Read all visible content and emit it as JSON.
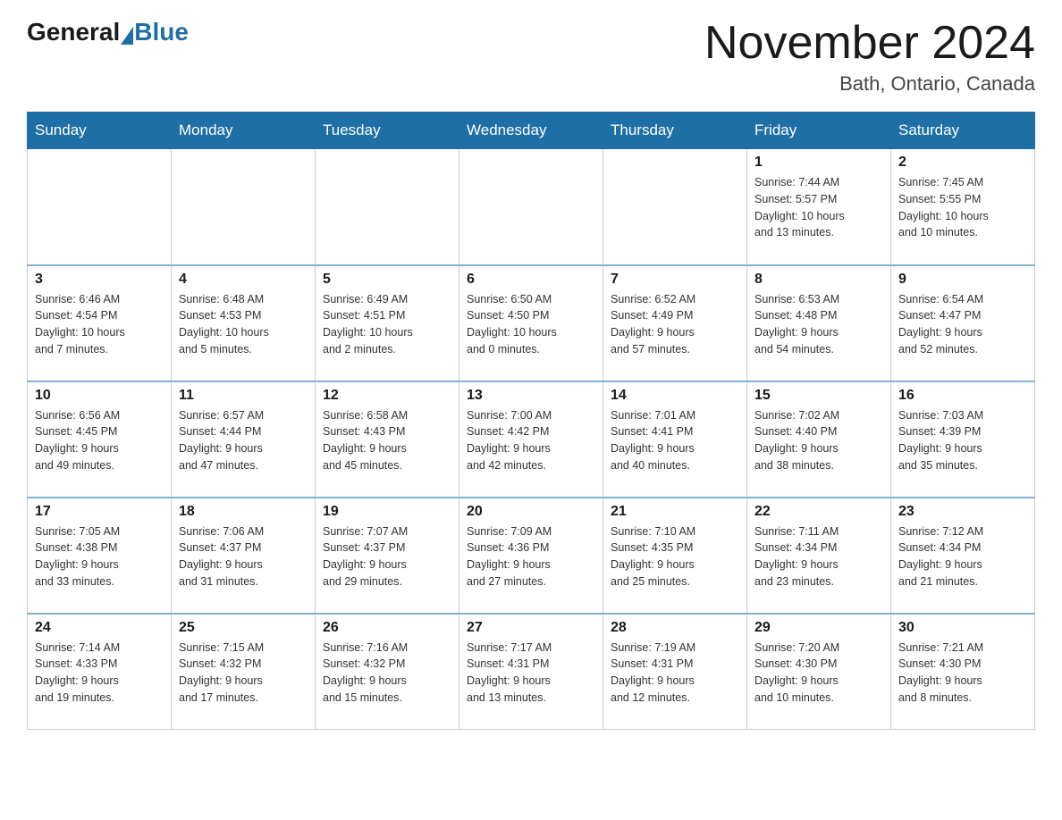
{
  "logo": {
    "general": "General",
    "blue": "Blue"
  },
  "title": "November 2024",
  "location": "Bath, Ontario, Canada",
  "days_of_week": [
    "Sunday",
    "Monday",
    "Tuesday",
    "Wednesday",
    "Thursday",
    "Friday",
    "Saturday"
  ],
  "weeks": [
    [
      {
        "day": "",
        "info": ""
      },
      {
        "day": "",
        "info": ""
      },
      {
        "day": "",
        "info": ""
      },
      {
        "day": "",
        "info": ""
      },
      {
        "day": "",
        "info": ""
      },
      {
        "day": "1",
        "info": "Sunrise: 7:44 AM\nSunset: 5:57 PM\nDaylight: 10 hours\nand 13 minutes."
      },
      {
        "day": "2",
        "info": "Sunrise: 7:45 AM\nSunset: 5:55 PM\nDaylight: 10 hours\nand 10 minutes."
      }
    ],
    [
      {
        "day": "3",
        "info": "Sunrise: 6:46 AM\nSunset: 4:54 PM\nDaylight: 10 hours\nand 7 minutes."
      },
      {
        "day": "4",
        "info": "Sunrise: 6:48 AM\nSunset: 4:53 PM\nDaylight: 10 hours\nand 5 minutes."
      },
      {
        "day": "5",
        "info": "Sunrise: 6:49 AM\nSunset: 4:51 PM\nDaylight: 10 hours\nand 2 minutes."
      },
      {
        "day": "6",
        "info": "Sunrise: 6:50 AM\nSunset: 4:50 PM\nDaylight: 10 hours\nand 0 minutes."
      },
      {
        "day": "7",
        "info": "Sunrise: 6:52 AM\nSunset: 4:49 PM\nDaylight: 9 hours\nand 57 minutes."
      },
      {
        "day": "8",
        "info": "Sunrise: 6:53 AM\nSunset: 4:48 PM\nDaylight: 9 hours\nand 54 minutes."
      },
      {
        "day": "9",
        "info": "Sunrise: 6:54 AM\nSunset: 4:47 PM\nDaylight: 9 hours\nand 52 minutes."
      }
    ],
    [
      {
        "day": "10",
        "info": "Sunrise: 6:56 AM\nSunset: 4:45 PM\nDaylight: 9 hours\nand 49 minutes."
      },
      {
        "day": "11",
        "info": "Sunrise: 6:57 AM\nSunset: 4:44 PM\nDaylight: 9 hours\nand 47 minutes."
      },
      {
        "day": "12",
        "info": "Sunrise: 6:58 AM\nSunset: 4:43 PM\nDaylight: 9 hours\nand 45 minutes."
      },
      {
        "day": "13",
        "info": "Sunrise: 7:00 AM\nSunset: 4:42 PM\nDaylight: 9 hours\nand 42 minutes."
      },
      {
        "day": "14",
        "info": "Sunrise: 7:01 AM\nSunset: 4:41 PM\nDaylight: 9 hours\nand 40 minutes."
      },
      {
        "day": "15",
        "info": "Sunrise: 7:02 AM\nSunset: 4:40 PM\nDaylight: 9 hours\nand 38 minutes."
      },
      {
        "day": "16",
        "info": "Sunrise: 7:03 AM\nSunset: 4:39 PM\nDaylight: 9 hours\nand 35 minutes."
      }
    ],
    [
      {
        "day": "17",
        "info": "Sunrise: 7:05 AM\nSunset: 4:38 PM\nDaylight: 9 hours\nand 33 minutes."
      },
      {
        "day": "18",
        "info": "Sunrise: 7:06 AM\nSunset: 4:37 PM\nDaylight: 9 hours\nand 31 minutes."
      },
      {
        "day": "19",
        "info": "Sunrise: 7:07 AM\nSunset: 4:37 PM\nDaylight: 9 hours\nand 29 minutes."
      },
      {
        "day": "20",
        "info": "Sunrise: 7:09 AM\nSunset: 4:36 PM\nDaylight: 9 hours\nand 27 minutes."
      },
      {
        "day": "21",
        "info": "Sunrise: 7:10 AM\nSunset: 4:35 PM\nDaylight: 9 hours\nand 25 minutes."
      },
      {
        "day": "22",
        "info": "Sunrise: 7:11 AM\nSunset: 4:34 PM\nDaylight: 9 hours\nand 23 minutes."
      },
      {
        "day": "23",
        "info": "Sunrise: 7:12 AM\nSunset: 4:34 PM\nDaylight: 9 hours\nand 21 minutes."
      }
    ],
    [
      {
        "day": "24",
        "info": "Sunrise: 7:14 AM\nSunset: 4:33 PM\nDaylight: 9 hours\nand 19 minutes."
      },
      {
        "day": "25",
        "info": "Sunrise: 7:15 AM\nSunset: 4:32 PM\nDaylight: 9 hours\nand 17 minutes."
      },
      {
        "day": "26",
        "info": "Sunrise: 7:16 AM\nSunset: 4:32 PM\nDaylight: 9 hours\nand 15 minutes."
      },
      {
        "day": "27",
        "info": "Sunrise: 7:17 AM\nSunset: 4:31 PM\nDaylight: 9 hours\nand 13 minutes."
      },
      {
        "day": "28",
        "info": "Sunrise: 7:19 AM\nSunset: 4:31 PM\nDaylight: 9 hours\nand 12 minutes."
      },
      {
        "day": "29",
        "info": "Sunrise: 7:20 AM\nSunset: 4:30 PM\nDaylight: 9 hours\nand 10 minutes."
      },
      {
        "day": "30",
        "info": "Sunrise: 7:21 AM\nSunset: 4:30 PM\nDaylight: 9 hours\nand 8 minutes."
      }
    ]
  ]
}
